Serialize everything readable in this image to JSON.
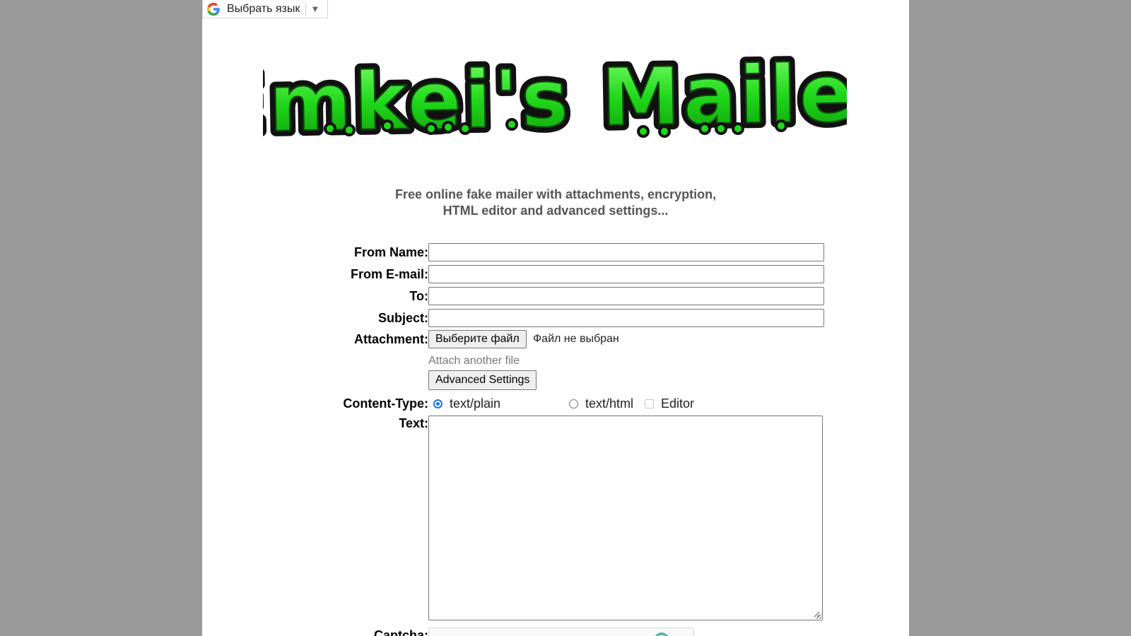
{
  "translate_widget": {
    "label": "Выбрать язык",
    "arrow": "▼",
    "icon": "google-g-icon"
  },
  "logo": {
    "text": "Emkei's Mailer",
    "color": "#1fd81a"
  },
  "tagline": {
    "line1": "Free online fake mailer with attachments, encryption,",
    "line2": "HTML editor and advanced settings..."
  },
  "form": {
    "from_name": {
      "label": "From Name:",
      "value": ""
    },
    "from_email": {
      "label": "From E-mail:",
      "value": ""
    },
    "to": {
      "label": "To:",
      "value": ""
    },
    "subject": {
      "label": "Subject:",
      "value": ""
    },
    "attachment": {
      "label": "Attachment:",
      "button": "Выберите файл",
      "status": "Файл не выбран",
      "attach_another": "Attach another file"
    },
    "advanced_settings": "Advanced Settings",
    "content_type": {
      "label": "Content-Type:",
      "options": [
        {
          "label": "text/plain",
          "selected": true
        },
        {
          "label": "text/html",
          "selected": false
        }
      ],
      "editor": {
        "label": "Editor",
        "checked": false
      }
    },
    "text": {
      "label": "Text:",
      "value": ""
    },
    "captcha": {
      "label": "Captcha:"
    }
  }
}
